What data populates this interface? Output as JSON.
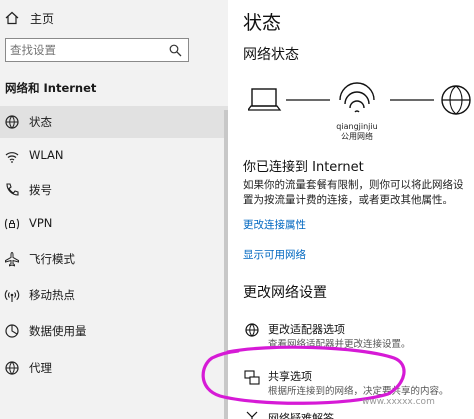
{
  "sidebar": {
    "home_label": "主页",
    "search_placeholder": "查找设置",
    "section_title": "网络和 Internet",
    "items": [
      {
        "label": "状态",
        "icon": "globe-icon"
      },
      {
        "label": "WLAN",
        "icon": "wifi-icon"
      },
      {
        "label": "拨号",
        "icon": "phone-icon"
      },
      {
        "label": "VPN",
        "icon": "vpn-icon"
      },
      {
        "label": "飞行模式",
        "icon": "airplane-icon"
      },
      {
        "label": "移动热点",
        "icon": "hotspot-icon"
      },
      {
        "label": "数据使用量",
        "icon": "data-usage-icon"
      },
      {
        "label": "代理",
        "icon": "globe-icon"
      }
    ]
  },
  "main": {
    "title": "状态",
    "network_status_heading": "网络状态",
    "diagram": {
      "ssid": "qiangjinjiu",
      "network_type": "公用网络"
    },
    "connected_text": "你已连接到 Internet",
    "description_line1": "如果你的流量套餐有限制，则你可以将此网络设",
    "description_line2": "置为按流量计费的连接，或者更改其他属性。",
    "links": {
      "change_properties": "更改连接属性",
      "show_networks": "显示可用网络"
    },
    "change_heading": "更改网络设置",
    "options": [
      {
        "title": "更改适配器选项",
        "desc": "查看网络适配器并更改连接设置。"
      },
      {
        "title": "共享选项",
        "desc": "根据所连接到的网络，决定要共享的内容。"
      },
      {
        "title": "网络疑难解答"
      }
    ]
  },
  "watermark": "www.xxxxx.com",
  "colors": {
    "accent": "#0067c0",
    "annotation": "#d61ad6",
    "sidebar_bg": "#f2f2f2"
  }
}
